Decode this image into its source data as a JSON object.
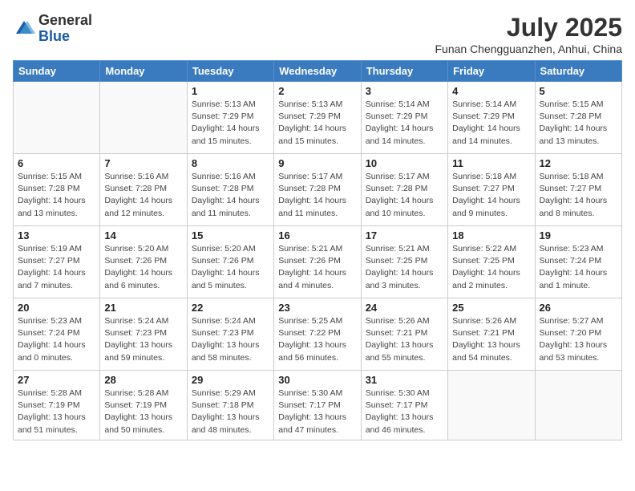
{
  "logo": {
    "general": "General",
    "blue": "Blue"
  },
  "header": {
    "month_title": "July 2025",
    "subtitle": "Funan Chengguanzhen, Anhui, China"
  },
  "weekdays": [
    "Sunday",
    "Monday",
    "Tuesday",
    "Wednesday",
    "Thursday",
    "Friday",
    "Saturday"
  ],
  "weeks": [
    [
      {
        "day": "",
        "info": ""
      },
      {
        "day": "",
        "info": ""
      },
      {
        "day": "1",
        "info": "Sunrise: 5:13 AM\nSunset: 7:29 PM\nDaylight: 14 hours and 15 minutes."
      },
      {
        "day": "2",
        "info": "Sunrise: 5:13 AM\nSunset: 7:29 PM\nDaylight: 14 hours and 15 minutes."
      },
      {
        "day": "3",
        "info": "Sunrise: 5:14 AM\nSunset: 7:29 PM\nDaylight: 14 hours and 14 minutes."
      },
      {
        "day": "4",
        "info": "Sunrise: 5:14 AM\nSunset: 7:29 PM\nDaylight: 14 hours and 14 minutes."
      },
      {
        "day": "5",
        "info": "Sunrise: 5:15 AM\nSunset: 7:28 PM\nDaylight: 14 hours and 13 minutes."
      }
    ],
    [
      {
        "day": "6",
        "info": "Sunrise: 5:15 AM\nSunset: 7:28 PM\nDaylight: 14 hours and 13 minutes."
      },
      {
        "day": "7",
        "info": "Sunrise: 5:16 AM\nSunset: 7:28 PM\nDaylight: 14 hours and 12 minutes."
      },
      {
        "day": "8",
        "info": "Sunrise: 5:16 AM\nSunset: 7:28 PM\nDaylight: 14 hours and 11 minutes."
      },
      {
        "day": "9",
        "info": "Sunrise: 5:17 AM\nSunset: 7:28 PM\nDaylight: 14 hours and 11 minutes."
      },
      {
        "day": "10",
        "info": "Sunrise: 5:17 AM\nSunset: 7:28 PM\nDaylight: 14 hours and 10 minutes."
      },
      {
        "day": "11",
        "info": "Sunrise: 5:18 AM\nSunset: 7:27 PM\nDaylight: 14 hours and 9 minutes."
      },
      {
        "day": "12",
        "info": "Sunrise: 5:18 AM\nSunset: 7:27 PM\nDaylight: 14 hours and 8 minutes."
      }
    ],
    [
      {
        "day": "13",
        "info": "Sunrise: 5:19 AM\nSunset: 7:27 PM\nDaylight: 14 hours and 7 minutes."
      },
      {
        "day": "14",
        "info": "Sunrise: 5:20 AM\nSunset: 7:26 PM\nDaylight: 14 hours and 6 minutes."
      },
      {
        "day": "15",
        "info": "Sunrise: 5:20 AM\nSunset: 7:26 PM\nDaylight: 14 hours and 5 minutes."
      },
      {
        "day": "16",
        "info": "Sunrise: 5:21 AM\nSunset: 7:26 PM\nDaylight: 14 hours and 4 minutes."
      },
      {
        "day": "17",
        "info": "Sunrise: 5:21 AM\nSunset: 7:25 PM\nDaylight: 14 hours and 3 minutes."
      },
      {
        "day": "18",
        "info": "Sunrise: 5:22 AM\nSunset: 7:25 PM\nDaylight: 14 hours and 2 minutes."
      },
      {
        "day": "19",
        "info": "Sunrise: 5:23 AM\nSunset: 7:24 PM\nDaylight: 14 hours and 1 minute."
      }
    ],
    [
      {
        "day": "20",
        "info": "Sunrise: 5:23 AM\nSunset: 7:24 PM\nDaylight: 14 hours and 0 minutes."
      },
      {
        "day": "21",
        "info": "Sunrise: 5:24 AM\nSunset: 7:23 PM\nDaylight: 13 hours and 59 minutes."
      },
      {
        "day": "22",
        "info": "Sunrise: 5:24 AM\nSunset: 7:23 PM\nDaylight: 13 hours and 58 minutes."
      },
      {
        "day": "23",
        "info": "Sunrise: 5:25 AM\nSunset: 7:22 PM\nDaylight: 13 hours and 56 minutes."
      },
      {
        "day": "24",
        "info": "Sunrise: 5:26 AM\nSunset: 7:21 PM\nDaylight: 13 hours and 55 minutes."
      },
      {
        "day": "25",
        "info": "Sunrise: 5:26 AM\nSunset: 7:21 PM\nDaylight: 13 hours and 54 minutes."
      },
      {
        "day": "26",
        "info": "Sunrise: 5:27 AM\nSunset: 7:20 PM\nDaylight: 13 hours and 53 minutes."
      }
    ],
    [
      {
        "day": "27",
        "info": "Sunrise: 5:28 AM\nSunset: 7:19 PM\nDaylight: 13 hours and 51 minutes."
      },
      {
        "day": "28",
        "info": "Sunrise: 5:28 AM\nSunset: 7:19 PM\nDaylight: 13 hours and 50 minutes."
      },
      {
        "day": "29",
        "info": "Sunrise: 5:29 AM\nSunset: 7:18 PM\nDaylight: 13 hours and 48 minutes."
      },
      {
        "day": "30",
        "info": "Sunrise: 5:30 AM\nSunset: 7:17 PM\nDaylight: 13 hours and 47 minutes."
      },
      {
        "day": "31",
        "info": "Sunrise: 5:30 AM\nSunset: 7:17 PM\nDaylight: 13 hours and 46 minutes."
      },
      {
        "day": "",
        "info": ""
      },
      {
        "day": "",
        "info": ""
      }
    ]
  ]
}
